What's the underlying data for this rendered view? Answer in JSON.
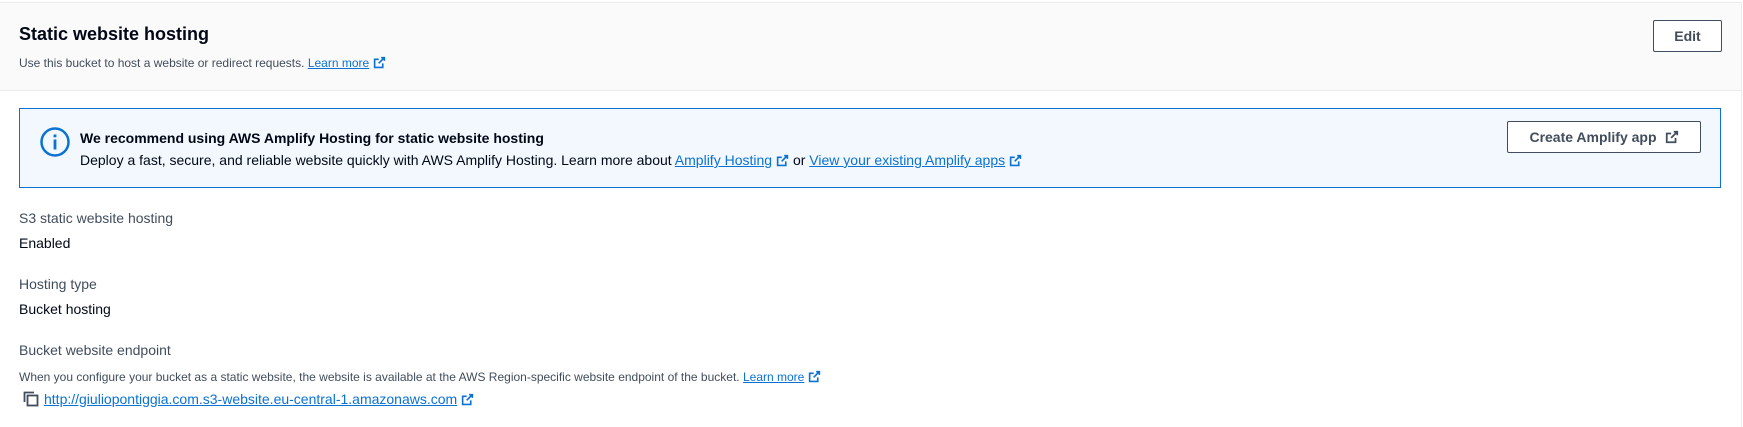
{
  "header": {
    "title": "Static website hosting",
    "description": "Use this bucket to host a website or redirect requests.",
    "learn_more": "Learn more",
    "edit_label": "Edit"
  },
  "info": {
    "title": "We recommend using AWS Amplify Hosting for static website hosting",
    "text_prefix": "Deploy a fast, secure, and reliable website quickly with AWS Amplify Hosting. Learn more about",
    "amplify_link": "Amplify Hosting",
    "or": "or",
    "view_apps_link": "View your existing Amplify apps",
    "create_button": "Create Amplify app"
  },
  "fields": {
    "s3_hosting": {
      "label": "S3 static website hosting",
      "value": "Enabled"
    },
    "hosting_type": {
      "label": "Hosting type",
      "value": "Bucket hosting"
    },
    "endpoint": {
      "label": "Bucket website endpoint",
      "description": "When you configure your bucket as a static website, the website is available at the AWS Region-specific website endpoint of the bucket.",
      "learn_more": "Learn more",
      "url": "http://giuliopontiggia.com.s3-website.eu-central-1.amazonaws.com"
    }
  },
  "colors": {
    "link": "#0972d3",
    "info_border": "#0972d3",
    "info_bg": "#f2f8fd",
    "header_bg": "#fafafa",
    "button_border": "#414d5c"
  },
  "icons": {
    "external": "external-link-icon",
    "info": "info-circle-icon",
    "copy": "copy-icon"
  }
}
